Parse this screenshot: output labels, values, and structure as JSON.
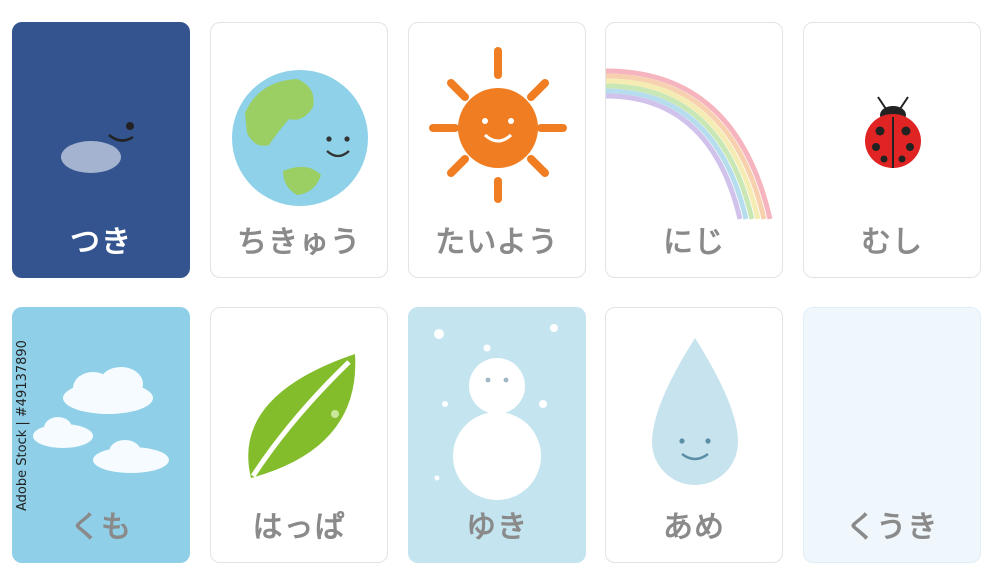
{
  "cards": [
    {
      "label": "つき",
      "icon": "moon-icon"
    },
    {
      "label": "ちきゅう",
      "icon": "earth-icon"
    },
    {
      "label": "たいよう",
      "icon": "sun-icon"
    },
    {
      "label": "にじ",
      "icon": "rainbow-icon"
    },
    {
      "label": "むし",
      "icon": "ladybug-icon"
    },
    {
      "label": "くも",
      "icon": "cloud-icon"
    },
    {
      "label": "はっぱ",
      "icon": "leaf-icon"
    },
    {
      "label": "ゆき",
      "icon": "snowman-icon"
    },
    {
      "label": "あめ",
      "icon": "raindrop-icon"
    },
    {
      "label": "くうき",
      "icon": "air-icon"
    }
  ],
  "watermark": "Adobe Stock | #49137890",
  "colors": {
    "moon_card": "#34548f",
    "cloud_card": "#8fd0e8",
    "snow_card": "#c4e5f0",
    "label_gray": "#8a8a8a"
  }
}
